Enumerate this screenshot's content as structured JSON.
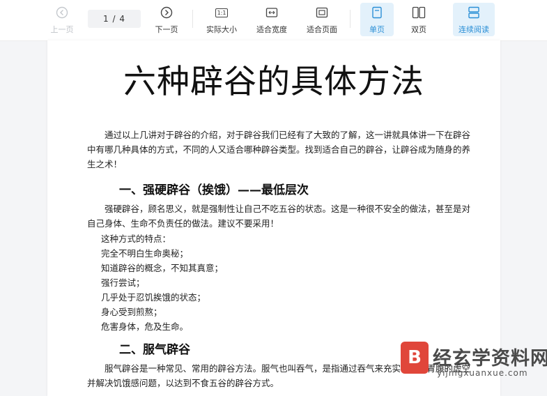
{
  "toolbar": {
    "prev_label": "上一页",
    "page_indicator": "1 / 4",
    "next_label": "下一页",
    "actual_size_label": "实际大小",
    "actual_size_icon_text": "1:1",
    "fit_width_label": "适合宽度",
    "fit_page_label": "适合页面",
    "single_page_label": "单页",
    "double_page_label": "双页",
    "continuous_label": "连续阅读",
    "accent_color": "#2b8fd6",
    "disabled_color": "#bfc3c8"
  },
  "document": {
    "title": "六种辟谷的具体方法",
    "intro": "通过以上几讲对于辟谷的介绍，对于辟谷我们已经有了大致的了解，这一讲就具体讲一下在辟谷中有哪几种具体的方式，不同的人又适合哪种辟谷类型。找到适合自己的辟谷，让辟谷成为随身的养生之术！",
    "section1": {
      "heading": "一、强硬辟谷（挨饿）——最低层次",
      "body": "强硬辟谷，顾名思义，就是强制性让自己不吃五谷的状态。这是一种很不安全的做法，甚至是对自己身体、生命不负责任的做法。建议不要采用！",
      "lines": [
        "这种方式的特点：",
        "完全不明白生命奥秘；",
        "知道辟谷的概念，不知其真意；",
        "强行尝试；",
        "几乎处于忍饥挨饿的状态；",
        "身心受到煎熬；",
        "危害身体，危及生命。"
      ]
    },
    "section2": {
      "heading": "二、服气辟谷",
      "body": "服气辟谷是一种常见、常用的辟谷方法。服气也叫吞气，是指通过吞气来充实、填充胃腹的虚空并解决饥饿感问题，以达到不食五谷的辟谷方式。"
    }
  },
  "watermark": {
    "logo_char": "B",
    "brand": "经玄学资料网",
    "url": "yijingxuanxue.com"
  }
}
